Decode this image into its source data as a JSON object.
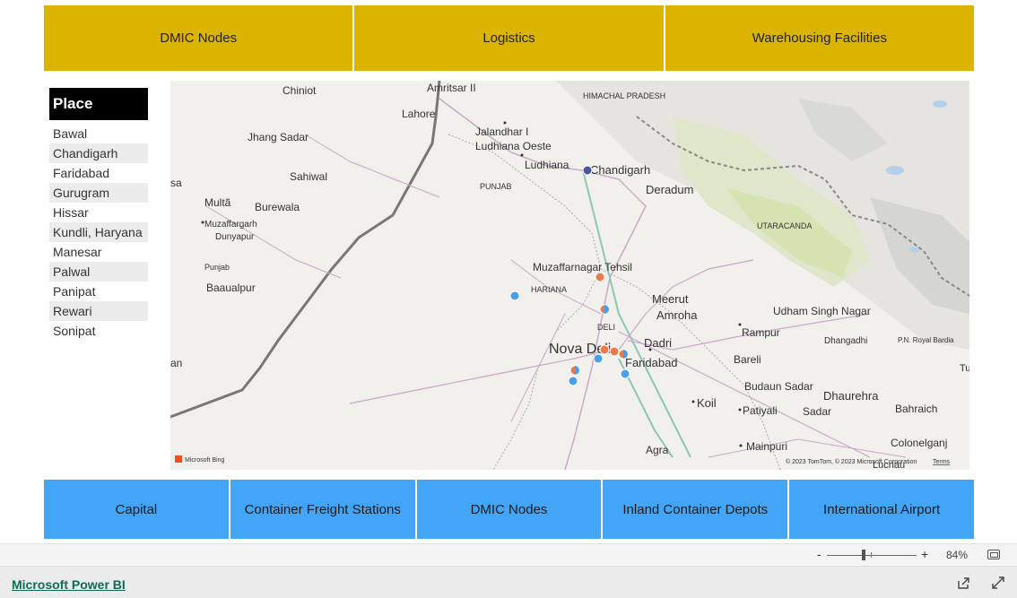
{
  "top_tabs": [
    "DMIC Nodes",
    "Logistics",
    "Warehousing Facilities"
  ],
  "slicer": {
    "title": "Place",
    "items": [
      "Bawal",
      "Chandigarh",
      "Faridabad",
      "Gurugram",
      "Hissar",
      "Kundli, Haryana",
      "Manesar",
      "Palwal",
      "Panipat",
      "Rewari",
      "Sonipat"
    ]
  },
  "map": {
    "labels": {
      "chiniot": "Chiniot",
      "amritsar": "Amritsar II",
      "himachal": "HIMACHAL PRADESH",
      "lahore": "Lahore",
      "jhang": "Jhang Sadar",
      "jalandhar": "Jalandhar I",
      "ludhiana_oeste": "Ludhiana Oeste",
      "ludhiana": "Ludhiana",
      "chandigarh": "Chandigarh",
      "sahiwal": "Sahiwal",
      "punjab": "PUNJAB",
      "deradum": "Deradum",
      "multa": "Multã",
      "burewala": "Burewala",
      "muzaffargarh": "Muzaffargarh",
      "dunyapur": "Dunyapur",
      "utaracanda": "UTARACANDA",
      "punjab_pk": "Punjab",
      "baaualpur": "Baaualpur",
      "muzaffarnagar": "Muzaffarnagar Tehsil",
      "haryana": "HARIANA",
      "meerut": "Meerut",
      "udham": "Udham Singh Nagar",
      "amroha": "Amroha",
      "deli": "DELI",
      "rampur": "Rampur",
      "dhangadhi": "Dhangadhi",
      "pn_royal": "P.N. Royal Bardia",
      "nova_deli": "Nova Deli",
      "dadri": "Dadri",
      "bareli": "Bareli",
      "faridabad": "Faridabad",
      "budaun": "Budaun Sadar",
      "dhaurehra": "Dhaurehra",
      "koil": "Koil",
      "patiyali": "Patiyali",
      "sadar": "Sadar",
      "bahraich": "Bahraich",
      "mainpuri": "Mainpuri",
      "colonelganj": "Colonelganj",
      "agra": "Agra",
      "lucnau": "Lucnau",
      "an": "an",
      "sa": "sa",
      "tu": "Tu"
    },
    "bing": "Microsoft Bing",
    "copyright": "© 2023 TomTom, © 2023 Microsoft Corporation",
    "terms": "Terms",
    "colors": {
      "blue_marker": "#4a9eea",
      "orange_marker": "#ec7a4a",
      "navy_marker": "#4a55a0"
    }
  },
  "bottom_tabs": [
    "Capital",
    "Container Freight Stations",
    "DMIC Nodes",
    "Inland Container Depots",
    "International Airport"
  ],
  "zoom": {
    "minus": "-",
    "plus": "+",
    "percent": "84%"
  },
  "footer": {
    "link": "Microsoft Power BI"
  },
  "colors": {
    "top_tab": "#dbb400",
    "bottom_tab": "#42a5f5",
    "slicer_header": "#000000"
  }
}
